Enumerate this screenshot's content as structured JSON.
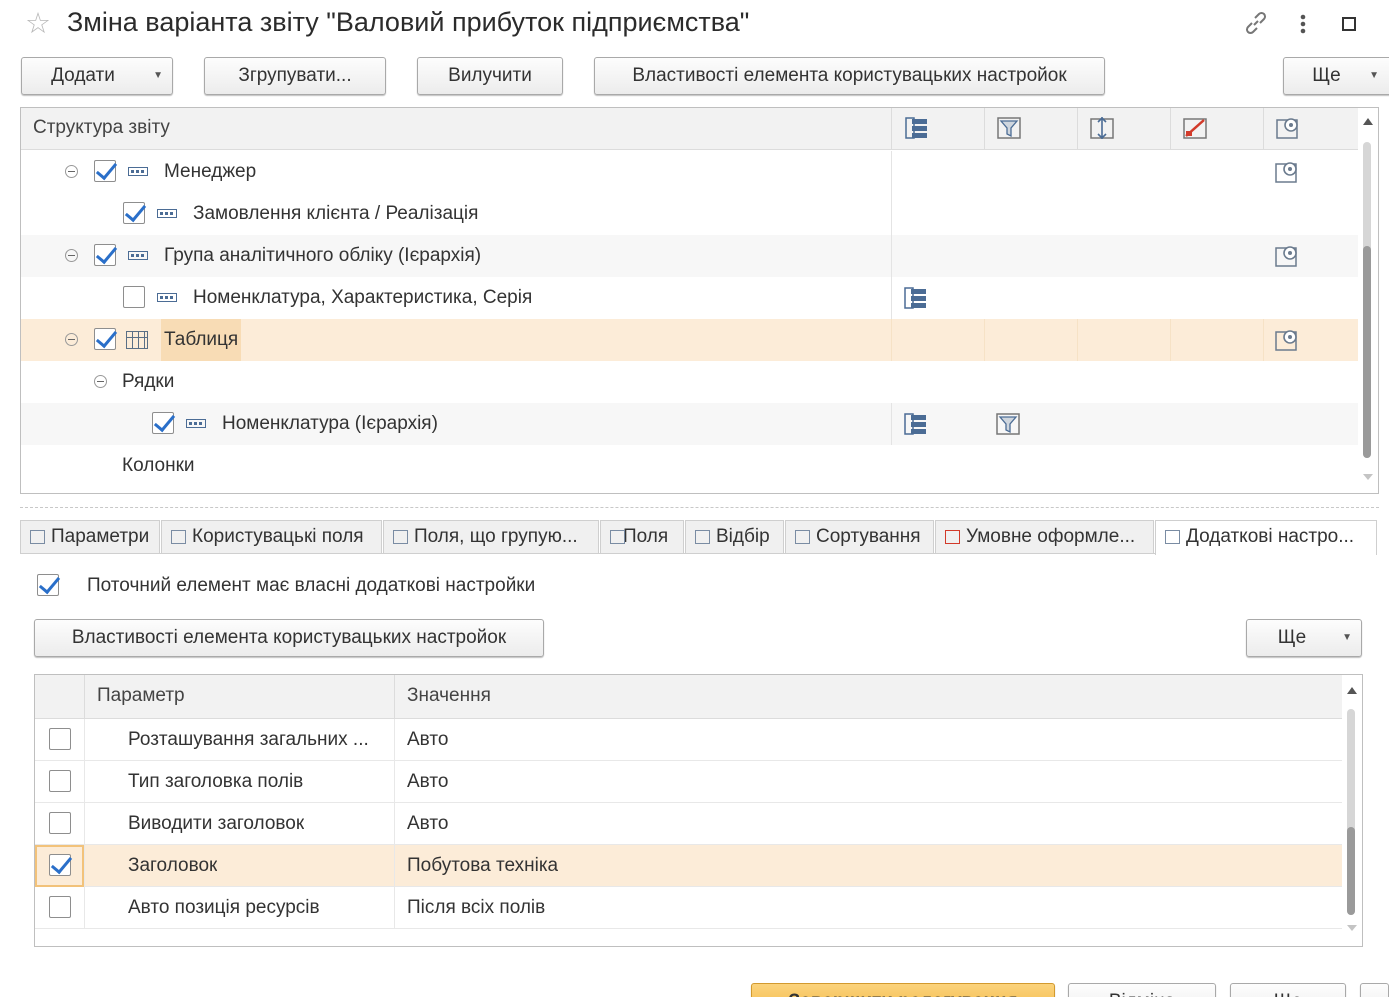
{
  "title": "Зміна варіанта звіту \"Валовий прибуток підприємства\"",
  "window_icons": [
    "link-icon",
    "more-icon",
    "maximize-icon"
  ],
  "toolbar": {
    "add": "Додати",
    "group": "Згрупувати...",
    "remove": "Вилучити",
    "props": "Властивості елемента користувацьких настройок",
    "more": "Ще"
  },
  "structure": {
    "header": "Структура звіту",
    "rows": [
      {
        "label": "Менеджер",
        "checked": true
      },
      {
        "label": "Замовлення клієнта / Реалізація",
        "checked": true
      },
      {
        "label": "Група аналітичного обліку (Ієрархія)",
        "checked": true
      },
      {
        "label": "Номенклатура, Характеристика, Серія",
        "checked": false
      },
      {
        "label": "Таблиця",
        "checked": true
      },
      {
        "label": "Рядки"
      },
      {
        "label": "Номенклатура (Ієрархія)",
        "checked": true
      },
      {
        "label": "Колонки"
      }
    ]
  },
  "tabs": [
    "Параметри",
    "Користувацькі поля",
    "Поля, що групую...",
    "Поля",
    "Відбір",
    "Сортування",
    "Умовне оформле...",
    "Додаткові настро..."
  ],
  "own_settings": {
    "label": "Поточний елемент має власні додаткові настройки",
    "checked": true
  },
  "panel": {
    "props": "Властивості елемента користувацьких настройок",
    "more": "Ще"
  },
  "params": {
    "col_param": "Параметр",
    "col_value": "Значення",
    "rows": [
      {
        "param": "Розташування загальних ...",
        "value": "Авто",
        "checked": false
      },
      {
        "param": "Тип заголовка полів",
        "value": "Авто",
        "checked": false
      },
      {
        "param": "Виводити заголовок",
        "value": "Авто",
        "checked": false
      },
      {
        "param": "Заголовок",
        "value": "Побутова техніка",
        "checked": true
      },
      {
        "param": "Авто позиція ресурсів",
        "value": "Після всіх полів",
        "checked": false
      }
    ]
  },
  "bottom": {
    "finish": "Завершити редагування",
    "cancel": "Відміна",
    "more": "Ще"
  },
  "colors": {
    "accent": "#f2b33e",
    "selection": "#fcecd8",
    "check": "#2a6fc9"
  }
}
